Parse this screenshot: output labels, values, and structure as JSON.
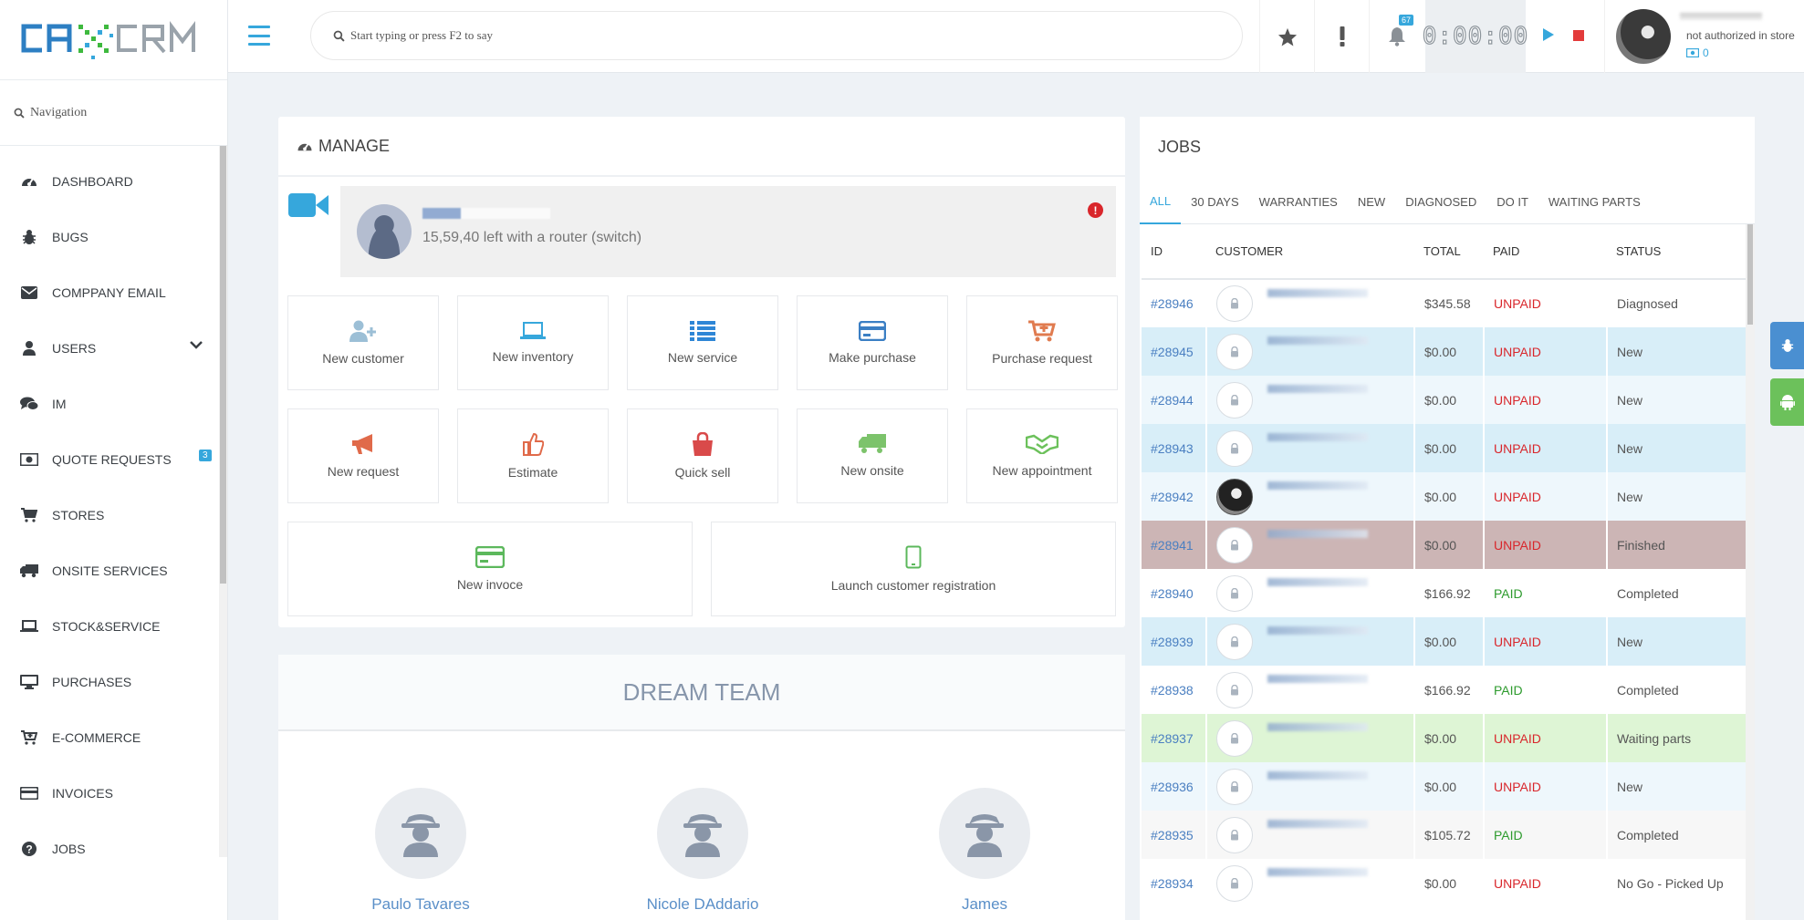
{
  "app": {
    "logo_text": "CAXCRM"
  },
  "header": {
    "search_placeholder": "Start typing or press F2 to say",
    "bell_count": "67",
    "timer": "0:00:00",
    "user_status": "not authorized in store",
    "user_points": "0"
  },
  "sidebar": {
    "search_label": "Navigation",
    "items": [
      {
        "label": "DASHBOARD",
        "icon": "dashboard-icon"
      },
      {
        "label": "BUGS",
        "icon": "bug-icon"
      },
      {
        "label": "COMPPANY EMAIL",
        "icon": "envelope-icon"
      },
      {
        "label": "USERS",
        "icon": "user-icon"
      },
      {
        "label": "IM",
        "icon": "chat-icon"
      },
      {
        "label": "QUOTE REQUESTS",
        "icon": "money-icon",
        "badge": "3"
      },
      {
        "label": "STORES",
        "icon": "cart-icon"
      },
      {
        "label": "ONSITE SERVICES",
        "icon": "truck-icon"
      },
      {
        "label": "STOCK&SERVICE",
        "icon": "laptop-icon"
      },
      {
        "label": "PURCHASES",
        "icon": "desktop-icon"
      },
      {
        "label": "E-COMMERCE",
        "icon": "cart-plus-icon"
      },
      {
        "label": "INVOICES",
        "icon": "credit-card-icon"
      },
      {
        "label": "JOBS",
        "icon": "question-icon"
      }
    ]
  },
  "manage": {
    "title": "MANAGE",
    "notice_text": "15,59,40 left with a router (switch)",
    "tiles": [
      {
        "label": "New customer",
        "color": "#9cbfd6"
      },
      {
        "label": "New inventory",
        "color": "#36a7dc"
      },
      {
        "label": "New service",
        "color": "#2e86d6"
      },
      {
        "label": "Make purchase",
        "color": "#3b7fc4"
      },
      {
        "label": "Purchase request",
        "color": "#e07b4f"
      },
      {
        "label": "New request",
        "color": "#e06a4a"
      },
      {
        "label": "Estimate",
        "color": "#e06a4a"
      },
      {
        "label": "Quick sell",
        "color": "#d94a4a"
      },
      {
        "label": "New onsite",
        "color": "#7cc36b"
      },
      {
        "label": "New appointment",
        "color": "#6cc15b"
      },
      {
        "label": "New invoce",
        "color": "#5cb85c"
      },
      {
        "label": "Launch customer registration",
        "color": "#5cb85c"
      }
    ]
  },
  "dream_team": {
    "title": "DREAM TEAM",
    "members": [
      "Paulo Tavares",
      "Nicole DAddario",
      "James"
    ]
  },
  "jobs": {
    "title": "JOBS",
    "tabs": [
      "ALL",
      "30 DAYS",
      "WARRANTIES",
      "NEW",
      "DIAGNOSED",
      "DO IT",
      "WAITING PARTS"
    ],
    "columns": [
      "ID",
      "CUSTOMER",
      "TOTAL",
      "PAID",
      "STATUS"
    ],
    "rows": [
      {
        "id": "#28946",
        "total": "$345.58",
        "paid": "UNPAID",
        "status": "Diagnosed",
        "bg": 0
      },
      {
        "id": "#28945",
        "total": "$0.00",
        "paid": "UNPAID",
        "status": "New",
        "bg": 1
      },
      {
        "id": "#28944",
        "total": "$0.00",
        "paid": "UNPAID",
        "status": "New",
        "bg": 2
      },
      {
        "id": "#28943",
        "total": "$0.00",
        "paid": "UNPAID",
        "status": "New",
        "bg": 1
      },
      {
        "id": "#28942",
        "total": "$0.00",
        "paid": "UNPAID",
        "status": "New",
        "bg": 2,
        "photo": true
      },
      {
        "id": "#28941",
        "total": "$0.00",
        "paid": "UNPAID",
        "status": "Finished",
        "bg": 3
      },
      {
        "id": "#28940",
        "total": "$166.92",
        "paid": "PAID",
        "status": "Completed",
        "bg": 0
      },
      {
        "id": "#28939",
        "total": "$0.00",
        "paid": "UNPAID",
        "status": "New",
        "bg": 1
      },
      {
        "id": "#28938",
        "total": "$166.92",
        "paid": "PAID",
        "status": "Completed",
        "bg": 0
      },
      {
        "id": "#28937",
        "total": "$0.00",
        "paid": "UNPAID",
        "status": "Waiting parts",
        "bg": 4
      },
      {
        "id": "#28936",
        "total": "$0.00",
        "paid": "UNPAID",
        "status": "New",
        "bg": 2
      },
      {
        "id": "#28935",
        "total": "$105.72",
        "paid": "PAID",
        "status": "Completed",
        "bg": 5
      },
      {
        "id": "#28934",
        "total": "$0.00",
        "paid": "UNPAID",
        "status": "No Go - Picked Up",
        "bg": 0
      }
    ]
  }
}
